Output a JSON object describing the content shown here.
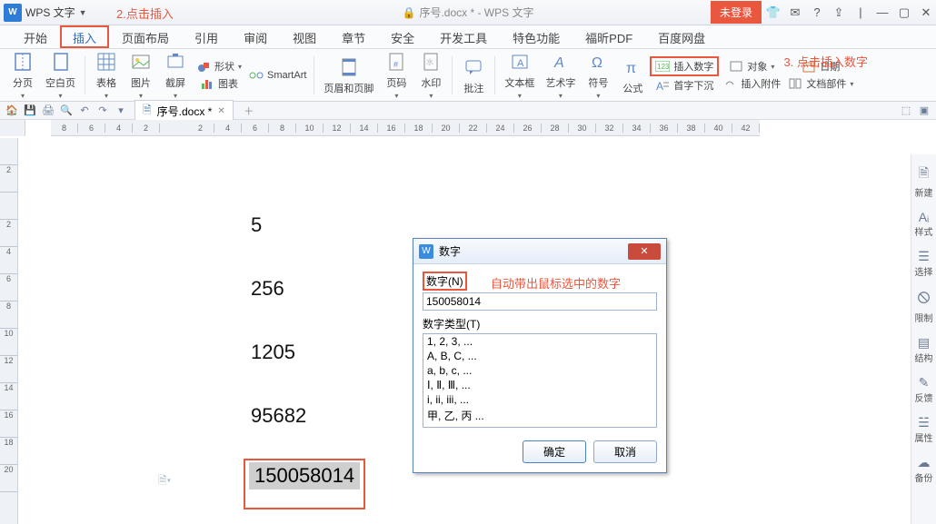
{
  "title_bar": {
    "app_name": "WPS 文字",
    "doc_title": "序号.docx * - WPS 文字",
    "login_label": "未登录"
  },
  "annotations": {
    "step2": "2.点击插入",
    "step3": "3. 点击插入数字",
    "auto_hint": "自动带出鼠标选中的数字"
  },
  "menu": {
    "start": "开始",
    "insert": "插入",
    "layout": "页面布局",
    "ref": "引用",
    "review": "审阅",
    "view": "视图",
    "chapter": "章节",
    "safe": "安全",
    "devtools": "开发工具",
    "special": "特色功能",
    "foxit": "福昕PDF",
    "baidu": "百度网盘"
  },
  "ribbon": {
    "split": "分页",
    "blank": "空白页",
    "table": "表格",
    "image": "图片",
    "screenshot": "截屏",
    "shape": "形状",
    "chart": "图表",
    "smartart": "SmartArt",
    "header_footer": "页眉和页脚",
    "pagenum": "页码",
    "watermark": "水印",
    "comment": "批注",
    "textbox": "文本框",
    "wordart": "艺术字",
    "symbol": "符号",
    "formula": "公式",
    "insert_num": "插入数字",
    "dropcap": "首字下沉",
    "object": "对象",
    "attach": "插入附件",
    "date": "日期",
    "docparts": "文档部件"
  },
  "doc_tab": {
    "name": "序号.docx *"
  },
  "content": {
    "l1": "5",
    "l2": "256",
    "l3": "1205",
    "l4": "95682",
    "selected": "150058014"
  },
  "dialog": {
    "title": "数字",
    "num_label": "数字(N)",
    "num_value": "150058014",
    "type_label": "数字类型(T)",
    "types": {
      "t1": "1, 2, 3, ...",
      "t2": "A, B, C, ...",
      "t3": "a, b, c, ...",
      "t4": "Ⅰ, Ⅱ, Ⅲ, ...",
      "t5": "i, ii, iii, ...",
      "t6": "甲, 乙, 丙 ..."
    },
    "ok": "确定",
    "cancel": "取消"
  },
  "side": {
    "new": "新建",
    "style": "样式",
    "select": "选择",
    "limit": "限制",
    "struct": "结构",
    "feedback": "反馈",
    "prop": "属性",
    "backup": "备份"
  },
  "ruler": [
    "8",
    "6",
    "4",
    "2",
    "",
    "2",
    "4",
    "6",
    "8",
    "10",
    "12",
    "14",
    "16",
    "18",
    "20",
    "22",
    "24",
    "26",
    "28",
    "30",
    "32",
    "34",
    "36",
    "38",
    "40",
    "42"
  ],
  "ruler_v": [
    "",
    "2",
    "",
    "2",
    "4",
    "6",
    "8",
    "10",
    "12",
    "14",
    "16",
    "18",
    "20"
  ]
}
